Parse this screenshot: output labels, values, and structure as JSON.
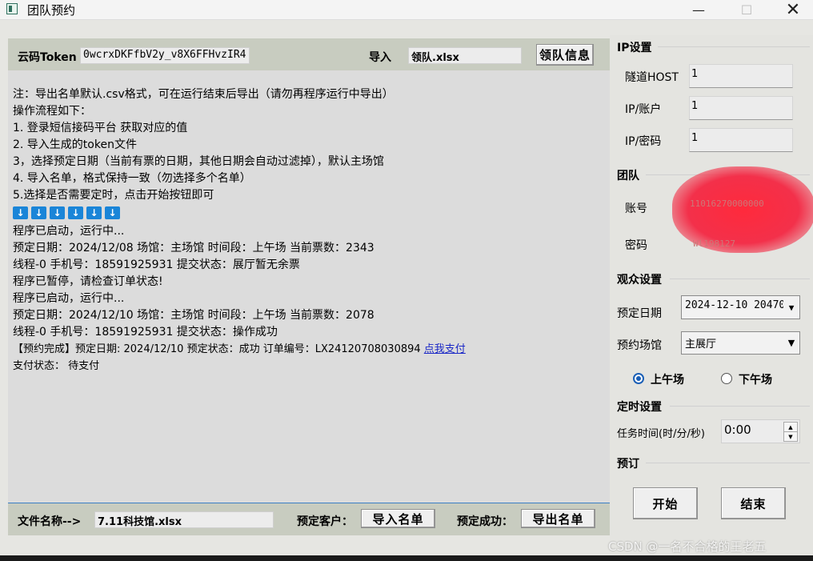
{
  "window": {
    "title": "团队预约",
    "minimize": "—",
    "maximize": "☐",
    "close": "✕"
  },
  "top": {
    "token_label": "云码Token",
    "token_value": "0wcrxDKFfbV2y_v8X6FFHvzIR4",
    "import_label": "导入",
    "import_file": "领队.xlsx",
    "leader_button": "领队信息"
  },
  "log": {
    "lines": [
      "注：导出名单默认.csv格式，可在运行结束后导出（请勿再程序运行中导出）",
      "操作流程如下：",
      "1. 登录短信接码平台 获取对应的值",
      "2. 导入生成的token文件",
      "3，选择预定日期（当前有票的日期，其他日期会自动过滤掉），默认主场馆",
      "4. 导入名单，格式保持一致（勿选择多个名单）",
      "5.选择是否需要定时，点击开始按钮即可"
    ],
    "arrow_icon": "↓",
    "run_lines": [
      "程序已启动，运行中...",
      "预定日期：2024/12/08  场馆：主场馆  时间段：上午场  当前票数：2343",
      "线程-0 手机号：18591925931 提交状态：展厅暂无余票",
      "程序已暂停，请检查订单状态!",
      "程序已启动，运行中...",
      "预定日期：2024/12/10  场馆：主场馆  时间段：上午场  当前票数：2078",
      "线程-0 手机号：18591925931 提交状态：操作成功"
    ],
    "complete_line": "【预约完成】预定日期: 2024/12/10 预定状态：成功 订单编号：LX24120708030894",
    "pay_link": "点我支付",
    "pay_status": "支付状态： 待支付"
  },
  "bottom": {
    "file_label": "文件名称-->",
    "file_value": "7.11科技馆.xlsx",
    "client_label": "预定客户：",
    "import_list_button": "导入名单",
    "success_label": "预定成功：",
    "export_list_button": "导出名单"
  },
  "ip": {
    "section": "IP设置",
    "host_label": "隧道HOST",
    "host_value": "1",
    "account_label": "IP/账户",
    "account_value": "1",
    "password_label": "IP/密码",
    "password_value": "1"
  },
  "team": {
    "section": "团队",
    "account_label": "账号",
    "account_value": "11016270000000",
    "password_label": "密码",
    "password_value": "Wl198127"
  },
  "audience": {
    "section": "观众设置",
    "date_label": "预定日期",
    "date_value": "2024-12-10 20470",
    "venue_label": "预约场馆",
    "venue_value": "主展厅",
    "morning": "上午场",
    "afternoon": "下午场",
    "selected": "上午场"
  },
  "timer": {
    "section": "定时设置",
    "task_label": "任务时间(时/分/秒)",
    "task_value": "0:00"
  },
  "booking": {
    "section": "预订",
    "start_button": "开始",
    "end_button": "结束"
  },
  "watermark": "CSDN @一名不合格的王老五",
  "colors": {
    "accent": "#1b5fb6",
    "link": "#1b28c6",
    "arrow_bg": "#1a85d8",
    "redaction": "#f3304a"
  }
}
